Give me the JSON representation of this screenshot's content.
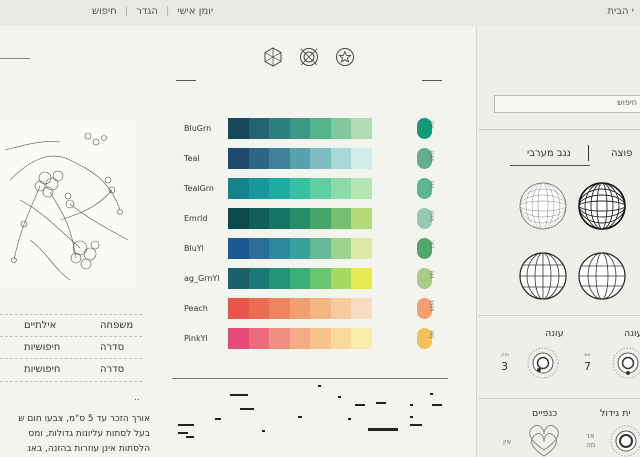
{
  "topbar": {
    "nav": [
      "יומן אישי",
      "הגדר",
      "חיפוש"
    ],
    "home": "י הבית"
  },
  "left": {
    "rows": [
      {
        "a": "אילתיים",
        "b": "משפחה"
      },
      {
        "a": "חיפושיות",
        "b": "סדרה"
      },
      {
        "a": "חיפושיות",
        "b": "סדרה"
      }
    ],
    "dots": "..",
    "paragraph": [
      "אורך הזכר עד 5 ס\"מ, צבעו חום ש",
      "בעל לסתות עליונות גדולות, ומס",
      "הלסתות אינן עוזרות בהזנה, באנ"
    ]
  },
  "icons": [
    "hexagon-icon",
    "target-icon",
    "star-icon"
  ],
  "palettes": [
    {
      "name": "BluGrn",
      "colors": [
        "#17485a",
        "#226471",
        "#2e7f7f",
        "#3b9a86",
        "#55b38c",
        "#80c89c",
        "#b2dbb3"
      ]
    },
    {
      "name": "Teal",
      "colors": [
        "#1f4a6f",
        "#2d6585",
        "#3f829a",
        "#5aa0ae",
        "#7fbdc2",
        "#a8d7d5",
        "#d0ece6"
      ]
    },
    {
      "name": "TealGrn",
      "colors": [
        "#13848c",
        "#15999a",
        "#1caea2",
        "#38c0a2",
        "#61cea2",
        "#8cdaa8",
        "#b6e5b4"
      ]
    },
    {
      "name": "Emrld",
      "colors": [
        "#0c4a4e",
        "#105f5a",
        "#147663",
        "#268d68",
        "#48a56a",
        "#78be70",
        "#b3d97a"
      ]
    },
    {
      "name": "BluYl",
      "colors": [
        "#1e5890",
        "#2a6e98",
        "#2f879c",
        "#39a19c",
        "#64ba96",
        "#9fd18f",
        "#dde9a5"
      ]
    },
    {
      "name": "ag_GrnYl",
      "colors": [
        "#1d5f6b",
        "#1b7a75",
        "#21947a",
        "#3ab078",
        "#6cc66f",
        "#a6da5f",
        "#e7ea4f"
      ]
    },
    {
      "name": "Peach",
      "colors": [
        "#e8574a",
        "#ec6c52",
        "#ef855e",
        "#f29f6f",
        "#f5b685",
        "#f7cba0",
        "#f8ddc0"
      ]
    },
    {
      "name": "PinkYl",
      "colors": [
        "#e54a79",
        "#ec6c7e",
        "#f28d82",
        "#f6aa86",
        "#f8c48e",
        "#f8da9b",
        "#f7ecad"
      ]
    }
  ],
  "pills": [
    {
      "color": "#109a7a",
      "code": "318"
    },
    {
      "color": "#63ae90",
      "code": "3395"
    },
    {
      "color": "#5cb694",
      "code": "346"
    },
    {
      "color": "#93cbb2",
      "code": "3395"
    },
    {
      "color": "#4fa86a",
      "code": "367"
    },
    {
      "color": "#a7cc83",
      "code": "346"
    },
    {
      "color": "#f3a06a",
      "code": "1595"
    },
    {
      "color": "#f4c158",
      "code": "381"
    }
  ],
  "right": {
    "search_label": "חיפוש",
    "tab_a": "נגב מערבי",
    "tab_b": "פוצה",
    "sec1": {
      "label_a": "עונה",
      "label_b": "עונה",
      "num_a": "3",
      "num_b": "7",
      "tiny_a": "חוק",
      "tiny_b": "אוג"
    },
    "sec2": {
      "label_a": "כנפיים",
      "label_b": "ית גידול",
      "tiny_a": "אין",
      "tiny_b": "אד\nמה"
    }
  }
}
